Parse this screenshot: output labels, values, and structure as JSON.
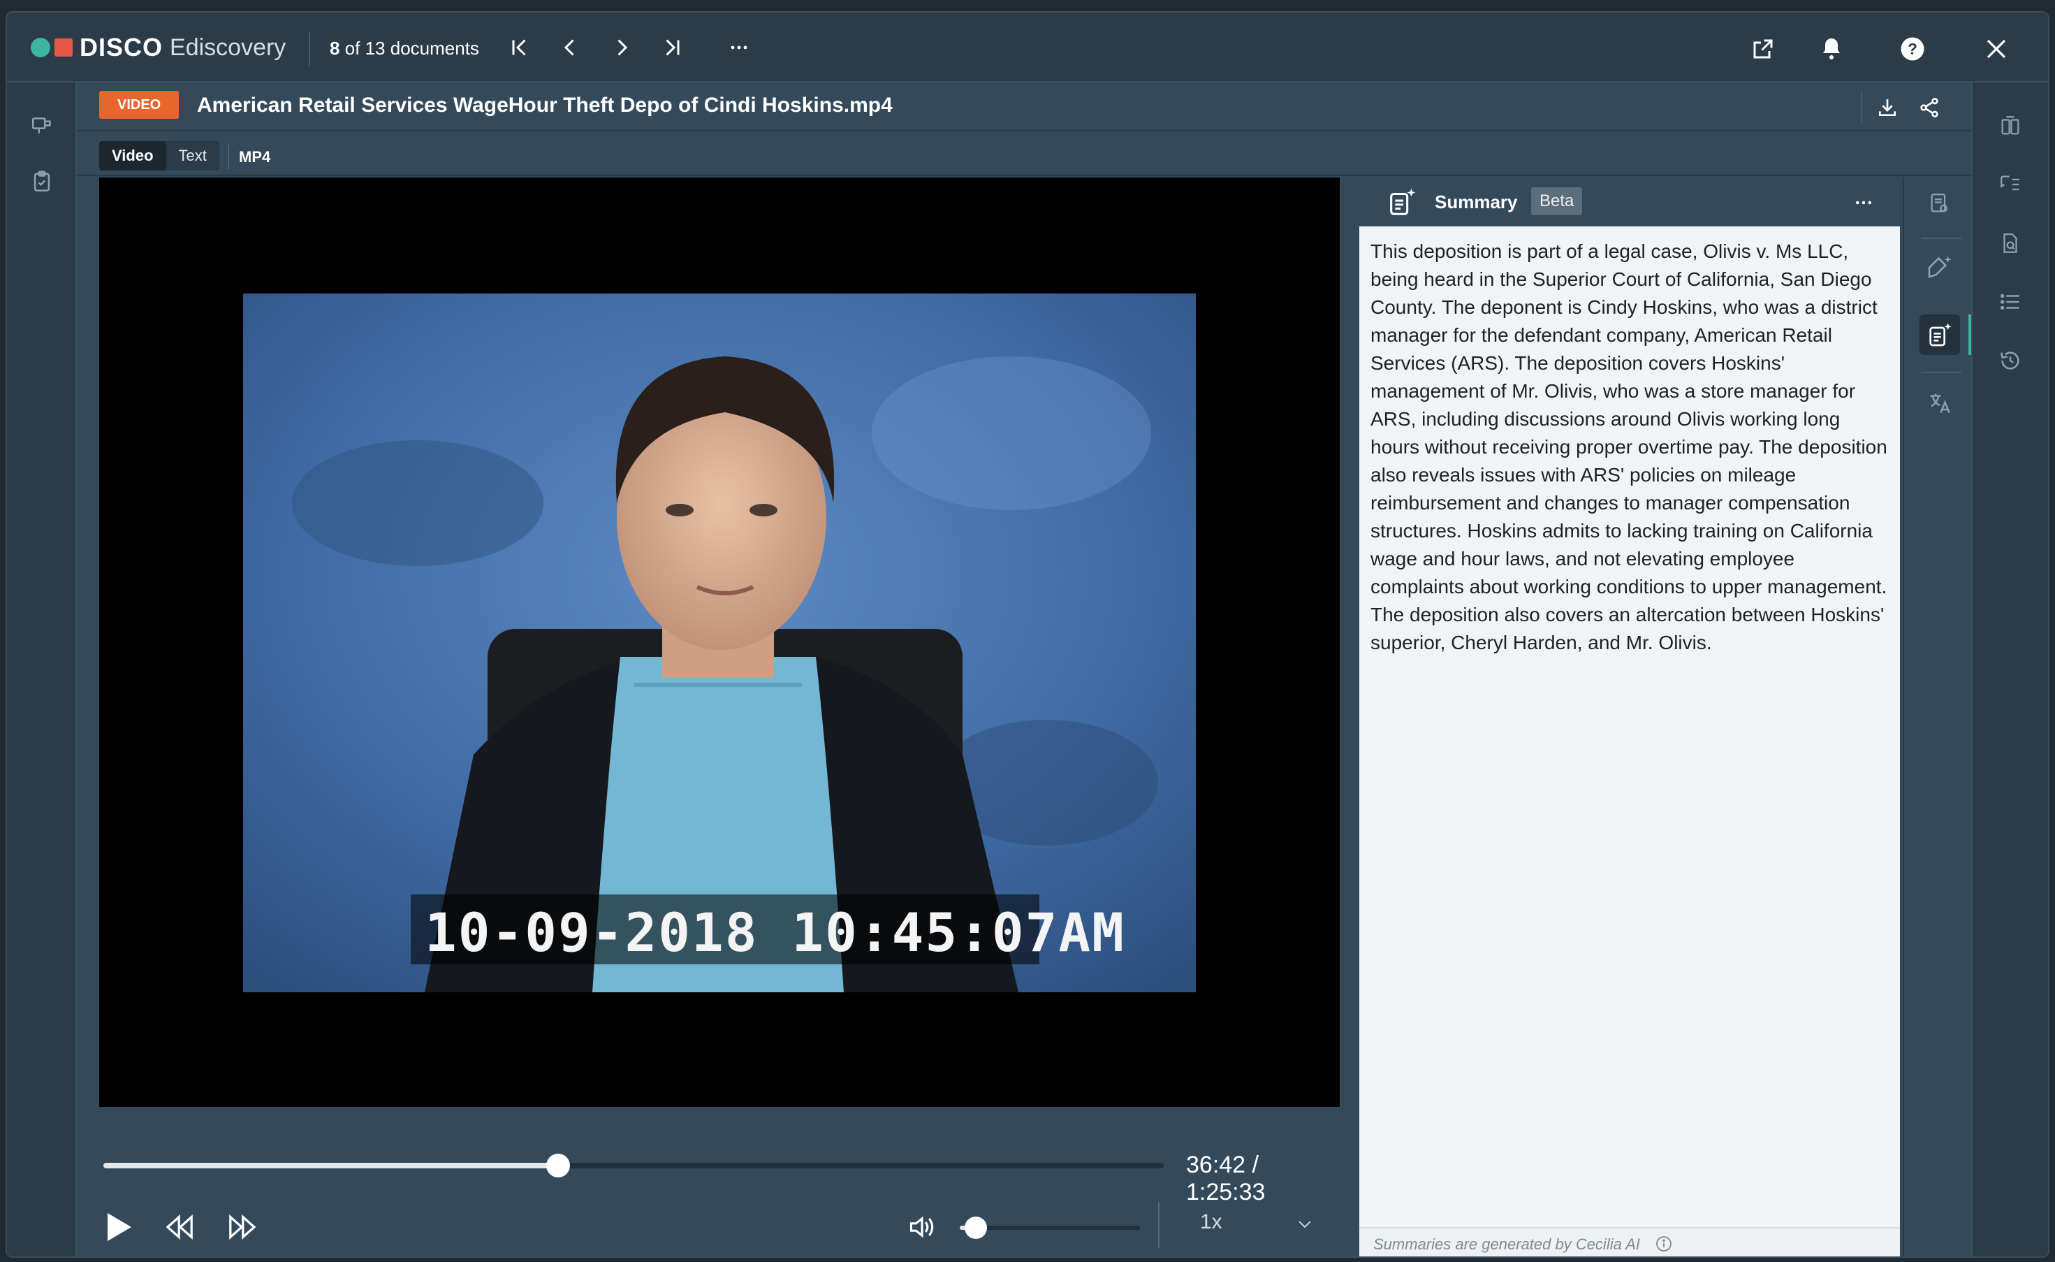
{
  "app": {
    "brand": "DISCO",
    "product": "Ediscovery"
  },
  "nav": {
    "position_current": "8",
    "position_rest": " of 13 documents"
  },
  "document": {
    "type_badge": "VIDEO",
    "title": "American Retail Services WageHour Theft Depo of Cindi Hoskins.mp4",
    "format": "MP4",
    "tabs": [
      {
        "label": "Video",
        "active": true
      },
      {
        "label": "Text",
        "active": false
      }
    ]
  },
  "player": {
    "burned_timestamp": "10-09-2018 10:45:07AM",
    "timecode": "36:42 / 1:25:33",
    "progress_fraction": 0.429,
    "volume_fraction": 0.09,
    "speed": "1x"
  },
  "summary": {
    "title": "Summary",
    "badge": "Beta",
    "text": "This deposition is part of a legal case, Olivis v. Ms LLC, being heard in the Superior Court of California, San Diego County. The deponent is Cindy Hoskins, who was a district manager for the defendant company, American Retail Services (ARS). The deposition covers Hoskins' management of Mr. Olivis, who was a store manager for ARS, including discussions around Olivis working long hours without receiving proper overtime pay. The deposition also reveals issues with ARS' policies on mileage reimbursement and changes to manager compensation structures. Hoskins admits to lacking training on California wage and hour laws, and not elevating employee complaints about working conditions to upper management. The deposition also covers an altercation between Hoskins' superior, Cheryl Harden, and Mr. Olivis.",
    "footer": "Summaries are generated by Cecilia AI"
  },
  "colors": {
    "accent_teal": "#3bb4a4",
    "accent_red": "#e8564a",
    "video_badge": "#e8652e",
    "chrome": "#34495a"
  },
  "icons": {
    "top": [
      "first-doc-icon",
      "prev-doc-icon",
      "next-doc-icon",
      "last-doc-icon",
      "more-icon",
      "open-external-icon",
      "bell-icon",
      "help-icon",
      "close-icon"
    ],
    "tools": [
      "doc-review-icon",
      "ai-tag-icon",
      "ai-summary-icon",
      "translate-icon"
    ]
  }
}
